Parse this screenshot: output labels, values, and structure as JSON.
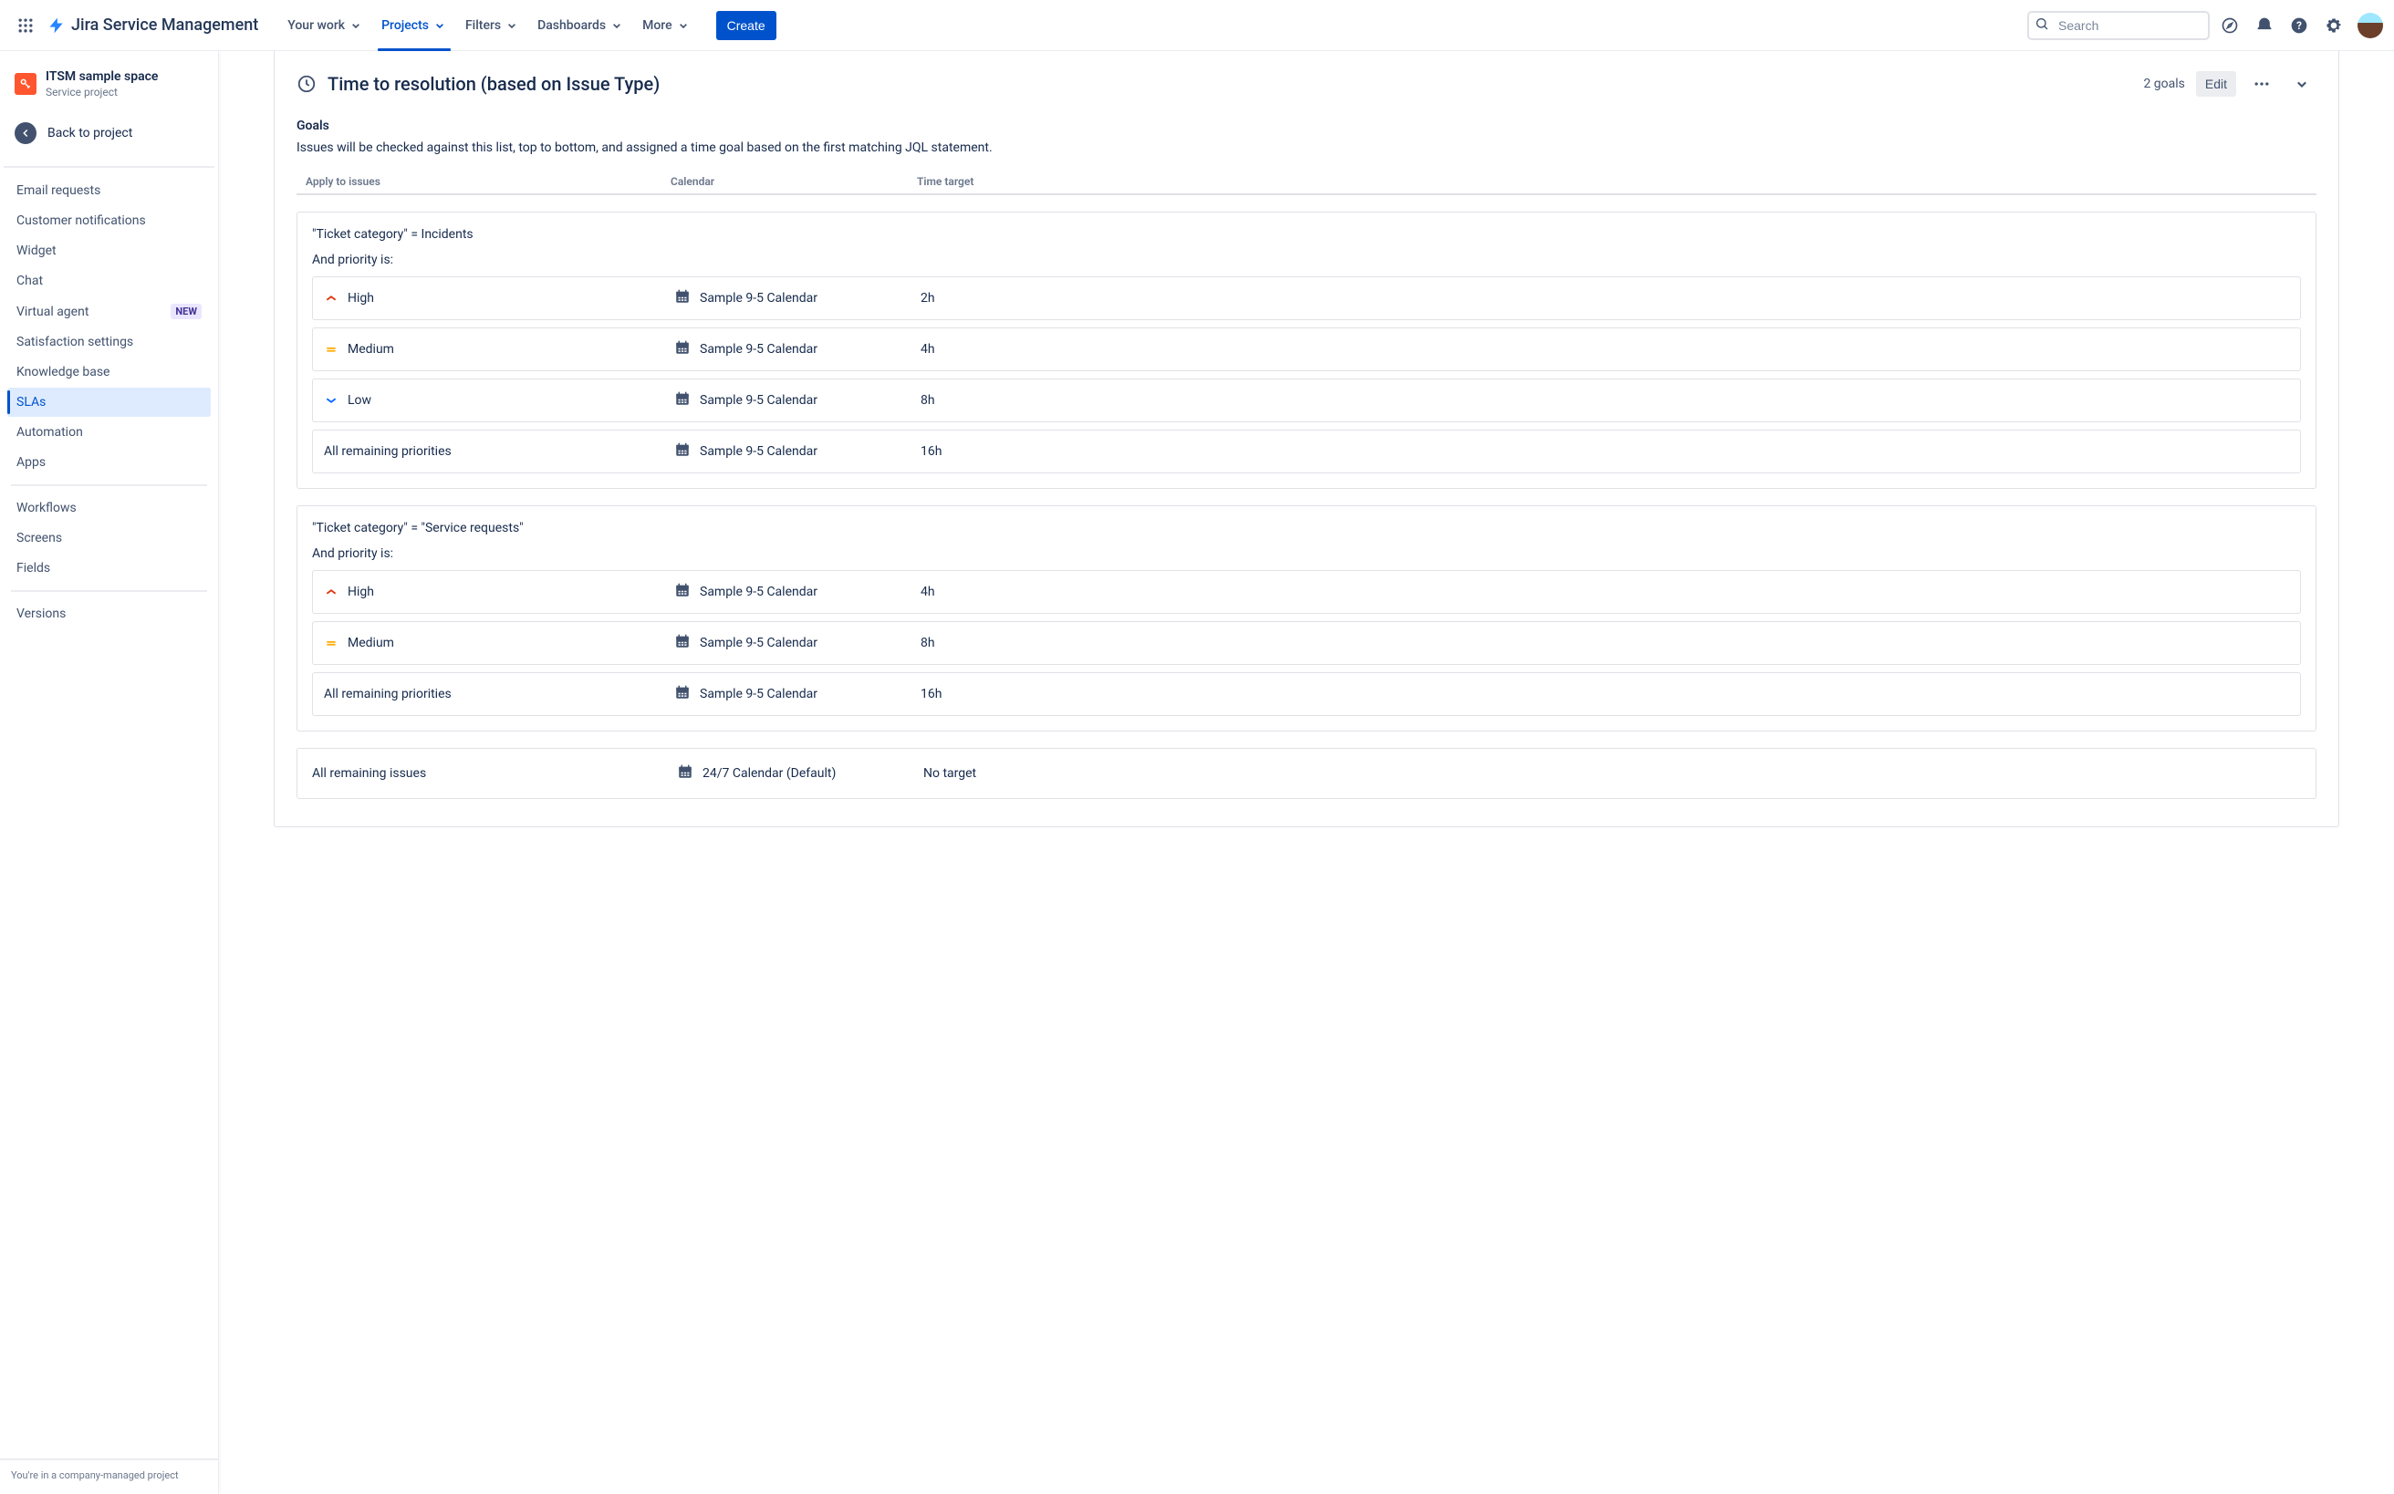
{
  "product": "Jira Service Management",
  "nav": {
    "items": [
      {
        "label": "Your work"
      },
      {
        "label": "Projects"
      },
      {
        "label": "Filters"
      },
      {
        "label": "Dashboards"
      },
      {
        "label": "More"
      }
    ],
    "create": "Create",
    "search_placeholder": "Search"
  },
  "sidebar": {
    "project_name": "ITSM sample space",
    "project_type": "Service project",
    "back": "Back to project",
    "groups": [
      [
        {
          "label": "Email requests"
        },
        {
          "label": "Customer notifications"
        },
        {
          "label": "Widget"
        },
        {
          "label": "Chat"
        },
        {
          "label": "Virtual agent",
          "badge": "NEW"
        },
        {
          "label": "Satisfaction settings"
        },
        {
          "label": "Knowledge base"
        },
        {
          "label": "SLAs",
          "selected": true
        },
        {
          "label": "Automation"
        },
        {
          "label": "Apps"
        }
      ],
      [
        {
          "label": "Workflows"
        },
        {
          "label": "Screens"
        },
        {
          "label": "Fields"
        }
      ],
      [
        {
          "label": "Versions"
        }
      ]
    ],
    "footer": "You're in a company-managed project"
  },
  "sla": {
    "title": "Time to resolution (based on Issue Type)",
    "goal_count": "2 goals",
    "edit": "Edit",
    "goals_heading": "Goals",
    "goals_desc": "Issues will be checked against this list, top to bottom, and assigned a time goal based on the first matching JQL statement.",
    "cols": {
      "c1": "Apply to issues",
      "c2": "Calendar",
      "c3": "Time target"
    },
    "groups": [
      {
        "jql": "\"Ticket category\" = Incidents",
        "sub": "And priority is:",
        "rows": [
          {
            "priority": "high",
            "label": "High",
            "calendar": "Sample 9-5 Calendar",
            "target": "2h"
          },
          {
            "priority": "medium",
            "label": "Medium",
            "calendar": "Sample 9-5 Calendar",
            "target": "4h"
          },
          {
            "priority": "low",
            "label": "Low",
            "calendar": "Sample 9-5 Calendar",
            "target": "8h"
          },
          {
            "priority": null,
            "label": "All remaining priorities",
            "calendar": "Sample 9-5 Calendar",
            "target": "16h"
          }
        ]
      },
      {
        "jql": "\"Ticket category\" = \"Service requests\"",
        "sub": "And priority is:",
        "rows": [
          {
            "priority": "high",
            "label": "High",
            "calendar": "Sample 9-5 Calendar",
            "target": "4h"
          },
          {
            "priority": "medium",
            "label": "Medium",
            "calendar": "Sample 9-5 Calendar",
            "target": "8h"
          },
          {
            "priority": null,
            "label": "All remaining priorities",
            "calendar": "Sample 9-5 Calendar",
            "target": "16h"
          }
        ]
      },
      {
        "jql": "All remaining issues",
        "rows": [
          {
            "priority": null,
            "label": null,
            "calendar": "24/7 Calendar (Default)",
            "target": "No target"
          }
        ]
      }
    ]
  }
}
